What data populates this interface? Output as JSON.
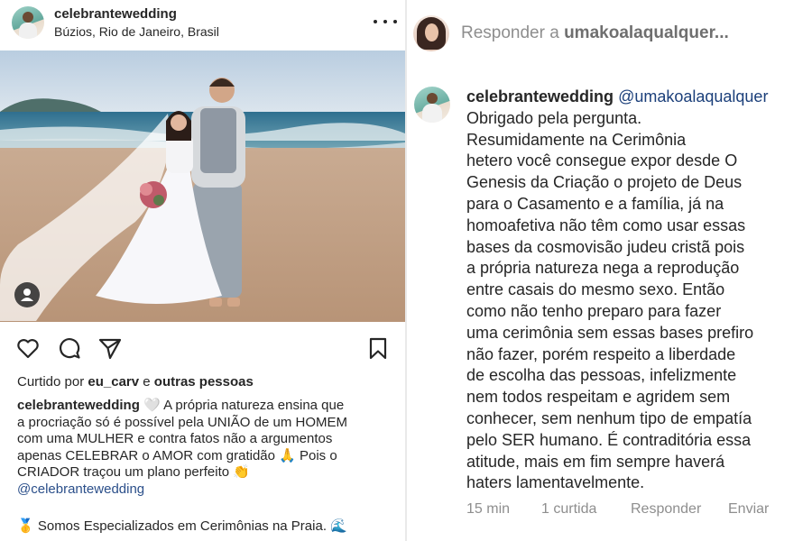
{
  "post": {
    "username": "celebrantewedding",
    "location": "Búzios, Rio de Janeiro, Brasil",
    "likes": {
      "prefix": "Curtido por",
      "user": "eu_carv",
      "conj": "e",
      "others": "outras pessoas"
    },
    "caption": {
      "username": "celebrantewedding",
      "line1": "🤍 A própria natureza ensina que",
      "line2": "a procriação só é possível pela UNIÃO de um HOMEM",
      "line3": "com uma MULHER e contra fatos não a argumentos",
      "line4": "apenas CELEBRAR o AMOR com gratidão 🙏 Pois o",
      "line5": "CRIADOR traçou um plano perfeito 👏",
      "mention": "@celebrantewedding",
      "line6": "🥇 Somos Especializados em Cerimônias na Praia. 🌊"
    }
  },
  "reply_bar": {
    "placeholder_prefix": "Responder a",
    "placeholder_user": "umakoalaqualquer..."
  },
  "comment": {
    "username": "celebrantewedding",
    "mention": "@umakoalaqualquer",
    "lines": [
      "Obrigado pela pergunta.",
      "Resumidamente na Cerimônia",
      "hetero você consegue expor desde O",
      "Genesis da Criação o projeto de Deus",
      "para o Casamento e a família, já na",
      "homoafetiva não têm como usar essas",
      "bases da cosmovisão judeu cristã pois",
      "a própria natureza nega a reprodução",
      "entre casais do mesmo sexo. Então",
      "como não tenho preparo para fazer",
      "uma cerimônia sem essas bases prefiro",
      "não fazer, porém respeito a liberdade",
      "de escolha das pessoas, infelizmente",
      "nem todos respeitam e agridem sem",
      "conhecer, sem nenhum tipo de empatía",
      "pelo SER humano. É contraditória essa",
      "atitude, mais em fim sempre haverá",
      "haters lamentavelmente."
    ],
    "meta": {
      "time": "15 min",
      "likes": "1 curtida",
      "reply": "Responder",
      "send": "Enviar"
    }
  },
  "icons": {
    "more": "more-options-icon",
    "heart": "heart-icon",
    "comment": "comment-icon",
    "share": "share-icon",
    "bookmark": "bookmark-icon",
    "user_tag": "user-tag-icon"
  },
  "colors": {
    "text": "#262626",
    "muted": "#8e8e8e",
    "mention": "#2b4f8a"
  }
}
